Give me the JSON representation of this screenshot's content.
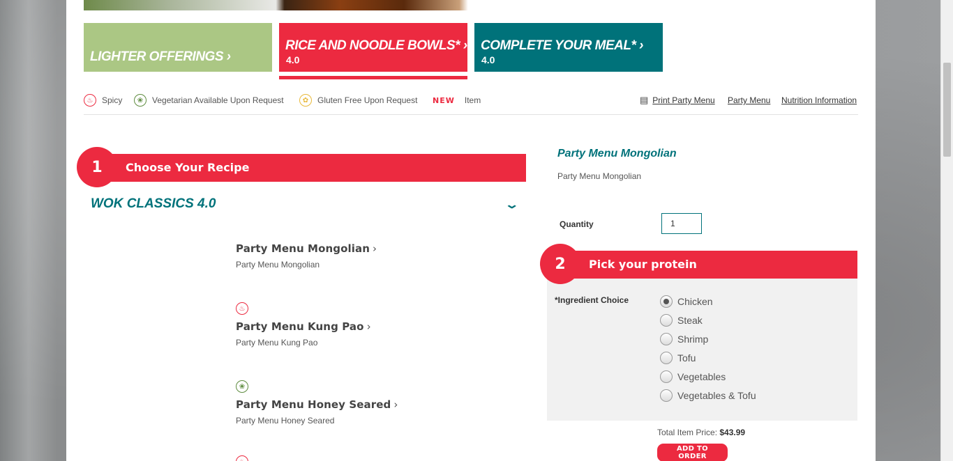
{
  "tabs": {
    "lighter": {
      "label": "Lighter Offerings ›"
    },
    "rice": {
      "label": "Rice and Noodle Bowls* ›",
      "version": "4.0"
    },
    "complete": {
      "label": "Complete Your Meal* ›",
      "version": "4.0"
    }
  },
  "legend": {
    "spicy": "Spicy",
    "vegetarian": "Vegetarian Available Upon Request",
    "gluten_free": "Gluten Free Upon Request",
    "new_badge": "NEW",
    "new_item": "Item"
  },
  "links": {
    "print": "Print Party Menu",
    "party_menu": "Party Menu",
    "nutrition": "Nutrition Information"
  },
  "step1": {
    "number": "1",
    "label": "Choose Your Recipe"
  },
  "section": {
    "title": "WOK CLASSICS 4.0"
  },
  "recipes": [
    {
      "name": "Party Menu Mongolian",
      "desc": "Party Menu Mongolian",
      "icon": "none"
    },
    {
      "name": "Party Menu Kung Pao",
      "desc": "Party Menu Kung Pao",
      "icon": "spicy-icon"
    },
    {
      "name": "Party Menu Honey Seared",
      "desc": "Party Menu Honey Seared",
      "icon": "vegetarian-icon"
    }
  ],
  "detail": {
    "title": "Party Menu Mongolian",
    "desc": "Party Menu Mongolian",
    "quantity_label": "Quantity",
    "quantity_value": "1"
  },
  "step2": {
    "number": "2",
    "label": "Pick your protein"
  },
  "protein": {
    "label": "*Ingredient Choice",
    "options": [
      "Chicken",
      "Steak",
      "Shrimp",
      "Tofu",
      "Vegetables",
      "Vegetables & Tofu"
    ],
    "selected": "Chicken"
  },
  "order": {
    "total_label": "Total Item Price:",
    "total_value": "$43.99",
    "add_button": "ADD TO ORDER"
  },
  "colors": {
    "red": "#ec2a40",
    "teal": "#00727a",
    "green": "#abc784"
  }
}
